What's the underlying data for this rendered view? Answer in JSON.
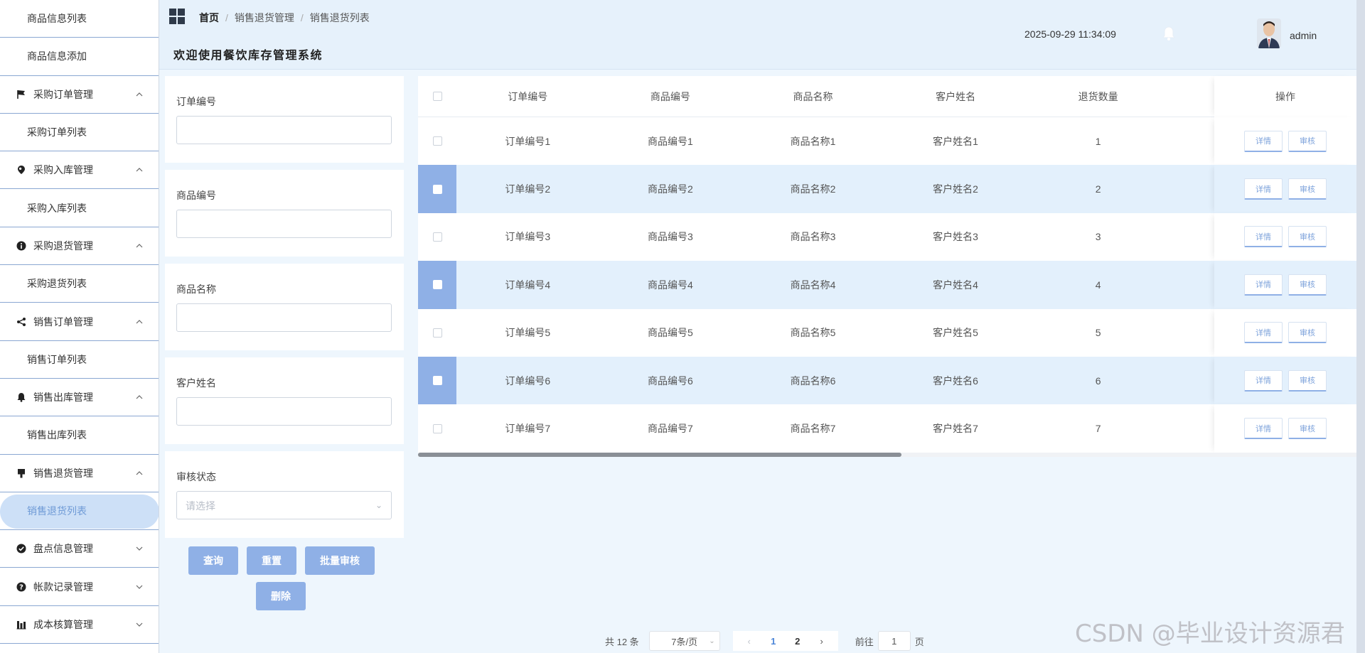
{
  "sidebar": {
    "items": [
      {
        "label": "商品信息列表",
        "type": "sub"
      },
      {
        "label": "商品信息添加",
        "type": "sub"
      },
      {
        "label": "采购订单管理",
        "type": "group",
        "icon": "flag-icon",
        "chevron": "^"
      },
      {
        "label": "采购订单列表",
        "type": "sub"
      },
      {
        "label": "采购入库管理",
        "type": "group",
        "icon": "pin-icon",
        "chevron": "^"
      },
      {
        "label": "采购入库列表",
        "type": "sub"
      },
      {
        "label": "采购退货管理",
        "type": "group",
        "icon": "info-icon",
        "chevron": "^"
      },
      {
        "label": "采购退货列表",
        "type": "sub"
      },
      {
        "label": "销售订单管理",
        "type": "group",
        "icon": "share-icon",
        "chevron": "^"
      },
      {
        "label": "销售订单列表",
        "type": "sub"
      },
      {
        "label": "销售出库管理",
        "type": "group",
        "icon": "bell-icon",
        "chevron": "^"
      },
      {
        "label": "销售出库列表",
        "type": "sub"
      },
      {
        "label": "销售退货管理",
        "type": "group",
        "icon": "brush-icon",
        "chevron": "^"
      },
      {
        "label": "销售退货列表",
        "type": "sub",
        "active": true
      },
      {
        "label": "盘点信息管理",
        "type": "group",
        "icon": "check-circle-icon",
        "chevron": "v"
      },
      {
        "label": "帐款记录管理",
        "type": "group",
        "icon": "question-icon",
        "chevron": "v"
      },
      {
        "label": "成本核算管理",
        "type": "group",
        "icon": "bar-chart-icon",
        "chevron": "v"
      }
    ]
  },
  "header": {
    "breadcrumb": [
      "首页",
      "销售退货管理",
      "销售退货列表"
    ],
    "welcome": "欢迎使用餐饮库存管理系统",
    "datetime": "2025-09-29 11:34:09",
    "username": "admin"
  },
  "search": {
    "fields": [
      {
        "label": "订单编号",
        "value": ""
      },
      {
        "label": "商品编号",
        "value": ""
      },
      {
        "label": "商品名称",
        "value": ""
      },
      {
        "label": "客户姓名",
        "value": ""
      }
    ],
    "status_label": "审核状态",
    "status_placeholder": "请选择",
    "buttons": {
      "query": "查询",
      "reset": "重置",
      "batch": "批量审核",
      "delete": "删除"
    }
  },
  "table": {
    "headers": [
      "订单编号",
      "商品编号",
      "商品名称",
      "客户姓名",
      "退货数量",
      "操作"
    ],
    "rows": [
      {
        "order": "订单编号1",
        "product_no": "商品编号1",
        "product_name": "商品名称1",
        "customer": "客户姓名1",
        "qty": "1",
        "selected": false
      },
      {
        "order": "订单编号2",
        "product_no": "商品编号2",
        "product_name": "商品名称2",
        "customer": "客户姓名2",
        "qty": "2",
        "selected": true
      },
      {
        "order": "订单编号3",
        "product_no": "商品编号3",
        "product_name": "商品名称3",
        "customer": "客户姓名3",
        "qty": "3",
        "selected": false
      },
      {
        "order": "订单编号4",
        "product_no": "商品编号4",
        "product_name": "商品名称4",
        "customer": "客户姓名4",
        "qty": "4",
        "selected": true
      },
      {
        "order": "订单编号5",
        "product_no": "商品编号5",
        "product_name": "商品名称5",
        "customer": "客户姓名5",
        "qty": "5",
        "selected": false
      },
      {
        "order": "订单编号6",
        "product_no": "商品编号6",
        "product_name": "商品名称6",
        "customer": "客户姓名6",
        "qty": "6",
        "selected": true
      },
      {
        "order": "订单编号7",
        "product_no": "商品编号7",
        "product_name": "商品名称7",
        "customer": "客户姓名7",
        "qty": "7",
        "selected": false
      }
    ],
    "action_detail": "详情",
    "action_audit": "审核"
  },
  "pagination": {
    "total": "共 12 条",
    "page_size": "7条/页",
    "pages": [
      "1",
      "2"
    ],
    "current": "1",
    "goto_prefix": "前往",
    "goto_value": "1",
    "goto_suffix": "页"
  },
  "watermark": "CSDN @毕业设计资源君",
  "colors": {
    "accent": "#8fb0e6",
    "selected_row": "#e3f0fc",
    "header_bg": "#e6f1fb",
    "active_pill": "#cde0f7"
  }
}
